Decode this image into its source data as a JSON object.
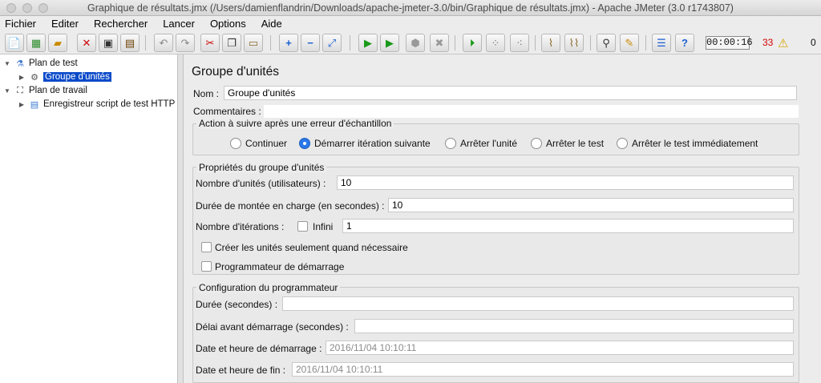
{
  "window": {
    "title": "Graphique de résultats.jmx (/Users/damienflandrin/Downloads/apache-jmeter-3.0/bin/Graphique de résultats.jmx) - Apache JMeter (3.0 r1743807)"
  },
  "menu": [
    "Fichier",
    "Editer",
    "Rechercher",
    "Lancer",
    "Options",
    "Aide"
  ],
  "toolbar": {
    "timer": "00:00:16",
    "error_count": "33",
    "warning_symbol": "⚠",
    "active_threads": "0"
  },
  "tree": {
    "test_plan": "Plan de test",
    "thread_group": "Groupe d'unités",
    "workbench": "Plan de travail",
    "recorder": "Enregistreur script de test HTTP"
  },
  "panel": {
    "title": "Groupe d'unités",
    "name_label": "Nom :",
    "name_value": "Groupe d'unités",
    "comments_label": "Commentaires :",
    "comments_value": "",
    "error_action": {
      "legend": "Action à suivre après une erreur d'échantillon",
      "options": [
        "Continuer",
        "Démarrer itération suivante",
        "Arrêter l'unité",
        "Arrêter le test",
        "Arrêter le test immédiatement"
      ],
      "selected": "Démarrer itération suivante"
    },
    "thread_props": {
      "legend": "Propriétés du groupe d'unités",
      "threads_label": "Nombre d'unités (utilisateurs) :",
      "threads_value": "10",
      "rampup_label": "Durée de montée en charge (en secondes) :",
      "rampup_value": "10",
      "iterations_label": "Nombre d'itérations :",
      "infinite_label": "Infini",
      "iterations_value": "1",
      "delay_create_label": "Créer les unités seulement quand nécessaire",
      "scheduler_label": "Programmateur de démarrage"
    },
    "scheduler": {
      "legend": "Configuration du programmateur",
      "duration_label": "Durée (secondes) :",
      "duration_value": "",
      "delay_label": "Délai avant démarrage (secondes) :",
      "delay_value": "",
      "start_label": "Date et heure de démarrage :",
      "start_value": "2016/11/04 10:10:11",
      "end_label": "Date et heure de fin :",
      "end_value": "2016/11/04 10:10:11"
    }
  }
}
